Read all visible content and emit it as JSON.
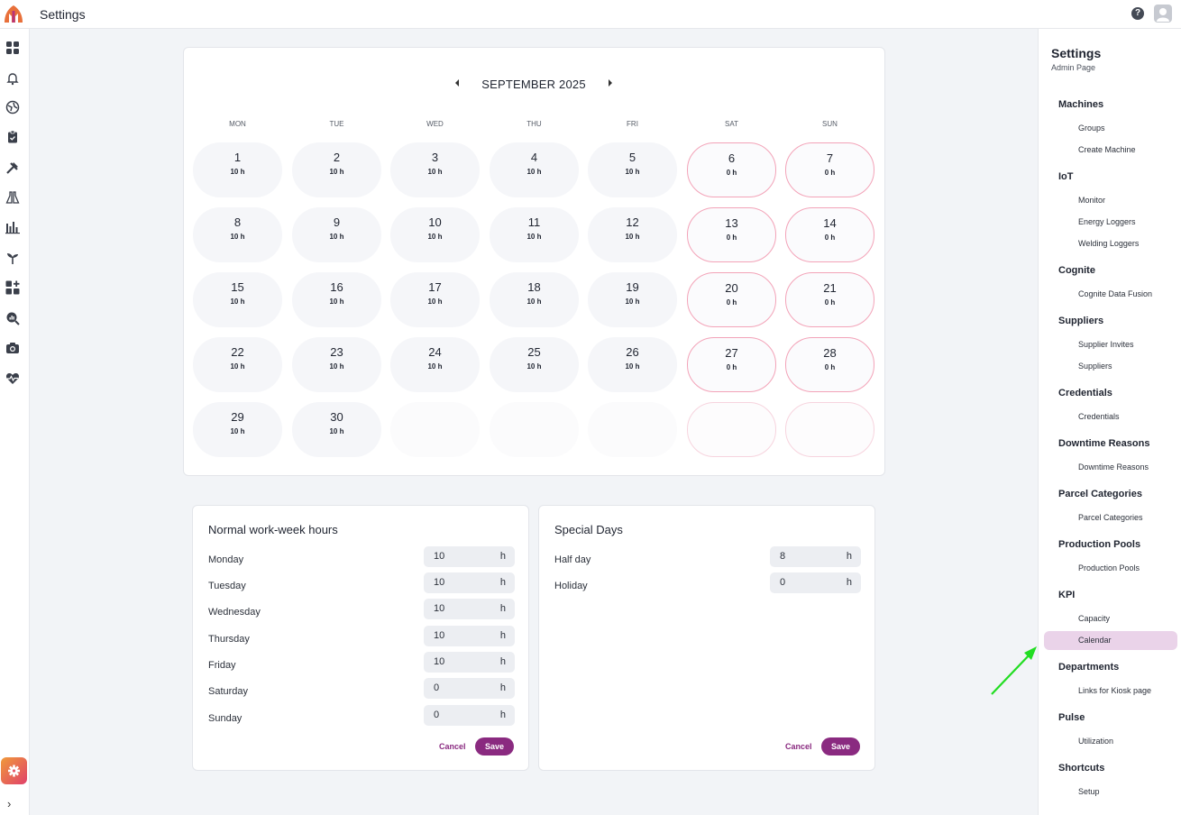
{
  "header": {
    "title": "Settings",
    "help_icon": "help-icon",
    "user_icon": "user-avatar-icon"
  },
  "rail": {
    "icons": [
      "dashboard-icon",
      "bell-icon",
      "globe-icon",
      "clipboard-icon",
      "tools-icon",
      "flask-icon",
      "bar-chart-icon",
      "sprout-icon",
      "add-widget-icon",
      "search-analytics-icon",
      "camera-icon",
      "heart-pulse-icon"
    ],
    "active": "gear-icon"
  },
  "calendar": {
    "month_label": "SEPTEMBER 2025",
    "weekdays": [
      "MON",
      "TUE",
      "WED",
      "THU",
      "FRI",
      "SAT",
      "SUN"
    ],
    "weeks": [
      [
        {
          "d": "1",
          "h": "10 h"
        },
        {
          "d": "2",
          "h": "10 h"
        },
        {
          "d": "3",
          "h": "10 h"
        },
        {
          "d": "4",
          "h": "10 h"
        },
        {
          "d": "5",
          "h": "10 h"
        },
        {
          "d": "6",
          "h": "0 h"
        },
        {
          "d": "7",
          "h": "0 h"
        }
      ],
      [
        {
          "d": "8",
          "h": "10 h"
        },
        {
          "d": "9",
          "h": "10 h"
        },
        {
          "d": "10",
          "h": "10 h"
        },
        {
          "d": "11",
          "h": "10 h"
        },
        {
          "d": "12",
          "h": "10 h"
        },
        {
          "d": "13",
          "h": "0 h"
        },
        {
          "d": "14",
          "h": "0 h"
        }
      ],
      [
        {
          "d": "15",
          "h": "10 h"
        },
        {
          "d": "16",
          "h": "10 h"
        },
        {
          "d": "17",
          "h": "10 h"
        },
        {
          "d": "18",
          "h": "10 h"
        },
        {
          "d": "19",
          "h": "10 h"
        },
        {
          "d": "20",
          "h": "0 h"
        },
        {
          "d": "21",
          "h": "0 h"
        }
      ],
      [
        {
          "d": "22",
          "h": "10 h"
        },
        {
          "d": "23",
          "h": "10 h"
        },
        {
          "d": "24",
          "h": "10 h"
        },
        {
          "d": "25",
          "h": "10 h"
        },
        {
          "d": "26",
          "h": "10 h"
        },
        {
          "d": "27",
          "h": "0 h"
        },
        {
          "d": "28",
          "h": "0 h"
        }
      ],
      [
        {
          "d": "29",
          "h": "10 h"
        },
        {
          "d": "30",
          "h": "10 h"
        },
        {
          "d": "",
          "h": ""
        },
        {
          "d": "",
          "h": ""
        },
        {
          "d": "",
          "h": ""
        },
        {
          "d": "",
          "h": ""
        },
        {
          "d": "",
          "h": ""
        }
      ]
    ]
  },
  "workweek": {
    "title": "Normal work-week hours",
    "rows": [
      {
        "label": "Monday",
        "value": "10",
        "unit": "h"
      },
      {
        "label": "Tuesday",
        "value": "10",
        "unit": "h"
      },
      {
        "label": "Wednesday",
        "value": "10",
        "unit": "h"
      },
      {
        "label": "Thursday",
        "value": "10",
        "unit": "h"
      },
      {
        "label": "Friday",
        "value": "10",
        "unit": "h"
      },
      {
        "label": "Saturday",
        "value": "0",
        "unit": "h"
      },
      {
        "label": "Sunday",
        "value": "0",
        "unit": "h"
      }
    ],
    "cancel_label": "Cancel",
    "save_label": "Save"
  },
  "special": {
    "title": "Special Days",
    "rows": [
      {
        "label": "Half day",
        "value": "8",
        "unit": "h"
      },
      {
        "label": "Holiday",
        "value": "0",
        "unit": "h"
      }
    ],
    "cancel_label": "Cancel",
    "save_label": "Save"
  },
  "side": {
    "title": "Settings",
    "subtitle": "Admin Page",
    "sections": [
      {
        "label": "Machines",
        "items": [
          "Groups",
          "Create Machine"
        ]
      },
      {
        "label": "IoT",
        "items": [
          "Monitor",
          "Energy Loggers",
          "Welding Loggers"
        ]
      },
      {
        "label": "Cognite",
        "items": [
          "Cognite Data Fusion"
        ]
      },
      {
        "label": "Suppliers",
        "items": [
          "Supplier Invites",
          "Suppliers"
        ]
      },
      {
        "label": "Credentials",
        "items": [
          "Credentials"
        ]
      },
      {
        "label": "Downtime Reasons",
        "items": [
          "Downtime Reasons"
        ]
      },
      {
        "label": "Parcel Categories",
        "items": [
          "Parcel Categories"
        ]
      },
      {
        "label": "Production Pools",
        "items": [
          "Production Pools"
        ]
      },
      {
        "label": "KPI",
        "items": [
          "Capacity",
          "Calendar"
        ]
      },
      {
        "label": "Departments",
        "items": [
          "Links for Kiosk page"
        ]
      },
      {
        "label": "Pulse",
        "items": [
          "Utilization"
        ]
      },
      {
        "label": "Shortcuts",
        "items": [
          "Setup"
        ]
      }
    ],
    "active_item": "Calendar"
  },
  "colors": {
    "accent": "#8a2a80",
    "weekend_border": "#f3a3b8",
    "active_bg": "#ead3e9",
    "arrow": "#22dd22"
  }
}
